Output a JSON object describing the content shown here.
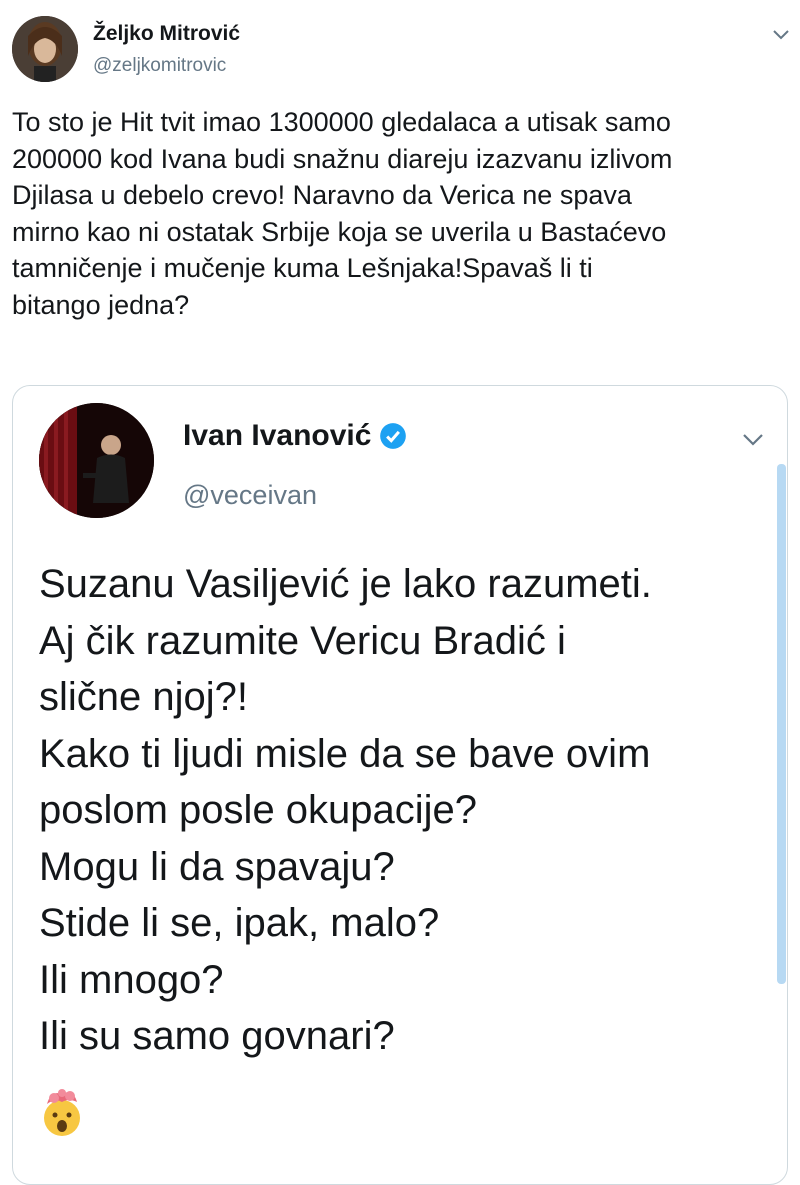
{
  "tweet": {
    "author": {
      "name": "Željko Mitrović",
      "handle": "@zeljkomitrovic"
    },
    "text": "To sto je Hit tvit imao 1300000 gledalaca a utisak samo\n200000 kod Ivana budi snažnu diareju izazvanu izlivom\nDjilasa u debelo crevo! Naravno da Verica ne spava\nmirno kao ni ostatak Srbije koja se uverila u Bastaćevo\ntamničenje i mučenje kuma Lešnjaka!Spavaš li ti\nbitango jedna?",
    "menu_icon": "chevron-down-icon"
  },
  "quoted_tweet": {
    "author": {
      "name": "Ivan Ivanović",
      "handle": "@veceivan",
      "verified": true
    },
    "lines": [
      "Suzanu Vasiljević je lako razumeti.",
      "Aj čik razumite Vericu Bradić i",
      "slične njoj?!",
      "Kako ti ljudi misle da se bave ovim",
      "poslom posle okupacije?",
      "Mogu li da spavaju?",
      "Stide li se, ipak, malo?",
      "Ili mnogo?",
      "Ili su samo govnari?"
    ],
    "emoji_icon": "exploding-head-emoji-icon",
    "menu_icon": "chevron-down-icon"
  },
  "colors": {
    "text": "#14171a",
    "secondary": "#657786",
    "verified_blue": "#1da1f2",
    "border": "#cfd9de"
  }
}
